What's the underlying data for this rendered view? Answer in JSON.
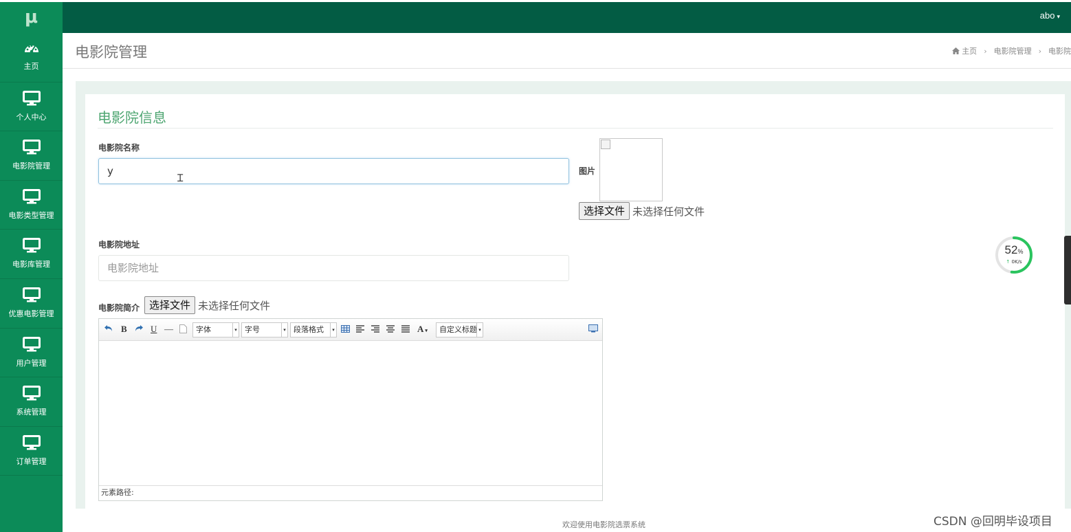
{
  "app": {
    "logo_text": "μ",
    "user_name": "abo",
    "caret": "▾"
  },
  "sidebar": {
    "items": [
      {
        "label": "主页",
        "icon": "dashboard-icon"
      },
      {
        "label": "个人中心",
        "icon": "monitor-icon"
      },
      {
        "label": "电影院管理",
        "icon": "monitor-icon"
      },
      {
        "label": "电影类型管理",
        "icon": "monitor-icon"
      },
      {
        "label": "电影库管理",
        "icon": "monitor-icon"
      },
      {
        "label": "优惠电影管理",
        "icon": "monitor-icon"
      },
      {
        "label": "用户管理",
        "icon": "monitor-icon"
      },
      {
        "label": "系统管理",
        "icon": "monitor-icon"
      },
      {
        "label": "订单管理",
        "icon": "monitor-icon"
      }
    ]
  },
  "header": {
    "title": "电影院管理",
    "breadcrumb": [
      "主页",
      "电影院管理",
      "电影院"
    ],
    "breadcrumb_sep": "›"
  },
  "panel": {
    "title": "电影院信息"
  },
  "form": {
    "name_label": "电影院名称",
    "name_value": "y",
    "image_label": "图片",
    "image_file_button": "选择文件",
    "image_file_status": "未选择任何文件",
    "address_label": "电影院地址",
    "address_placeholder": "电影院地址",
    "intro_label": "电影院简介",
    "intro_file_button": "选择文件",
    "intro_file_status": "未选择任何文件"
  },
  "editor": {
    "bold": "B",
    "underline": "U",
    "hr": "—",
    "font_select": "字体",
    "size_select": "字号",
    "paragraph_select": "段落格式",
    "font_color": "A",
    "custom_title_select": "自定义标题",
    "status_label": "元素路径:"
  },
  "widget": {
    "percent": 52,
    "percent_unit": "%",
    "speed": "0K/s",
    "arrow": "↑"
  },
  "footer": {
    "text": "欢迎使用电影院选票系统"
  },
  "watermark": "CSDN @回明毕设项目",
  "colors": {
    "topbar": "#035c44",
    "sidebar": "#0c8b58",
    "accent": "#4fa672",
    "progress": "#2ac45e"
  }
}
